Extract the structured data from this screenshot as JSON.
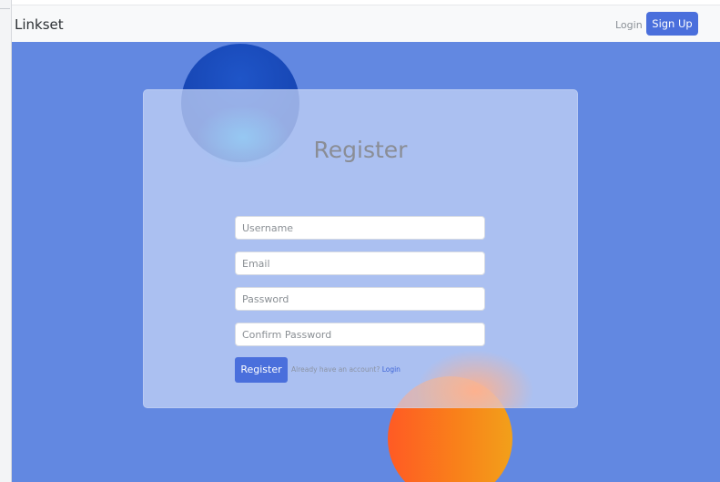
{
  "navbar": {
    "brand": "Linkset",
    "login_label": "Login",
    "signup_label": "Sign Up"
  },
  "form": {
    "title": "Register",
    "fields": {
      "username_placeholder": "Username",
      "email_placeholder": "Email",
      "password_placeholder": "Password",
      "confirm_password_placeholder": "Confirm Password"
    },
    "submit_label": "Register",
    "already_text": "Already have an account?",
    "login_link": "Login"
  },
  "colors": {
    "background": "#6288e1",
    "primary": "#4a6fdc",
    "blob_blue": "#1746b4",
    "blob_orange": "#ff5a24"
  }
}
